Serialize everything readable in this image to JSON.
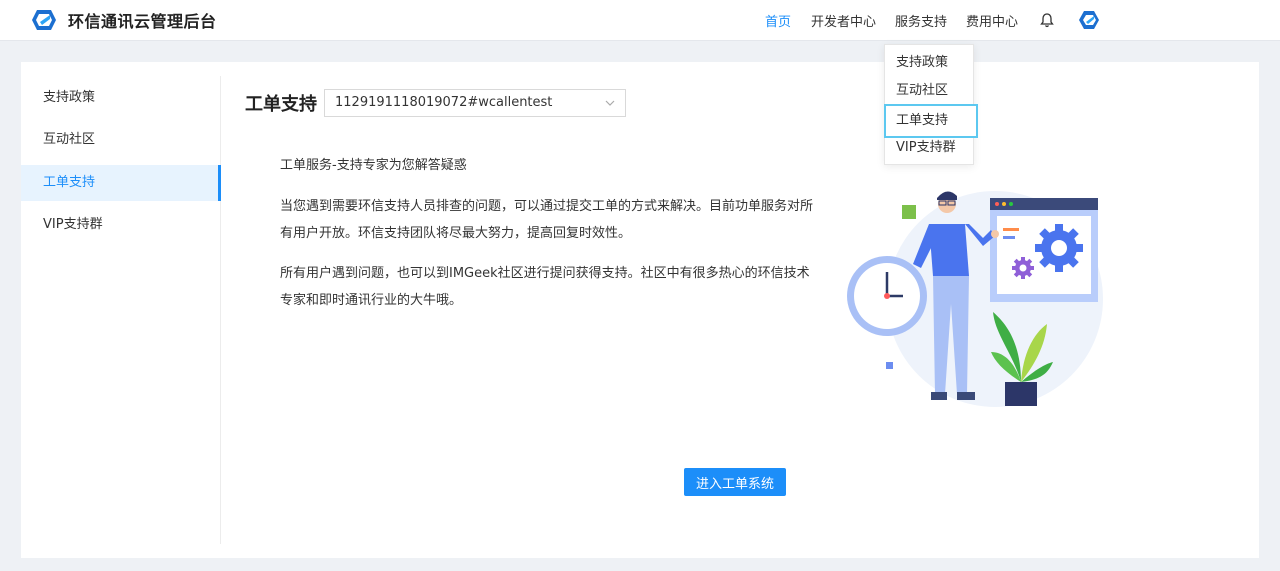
{
  "app": {
    "title": "环信通讯云管理后台"
  },
  "nav": {
    "items": [
      {
        "label": "首页",
        "active": true
      },
      {
        "label": "开发者中心",
        "active": false
      },
      {
        "label": "服务支持",
        "active": false
      },
      {
        "label": "费用中心",
        "active": false
      }
    ]
  },
  "dropdown": {
    "items": [
      {
        "label": "支持政策",
        "active": false
      },
      {
        "label": "互动社区",
        "active": false
      },
      {
        "label": "工单支持",
        "active": true
      },
      {
        "label": "VIP支持群",
        "active": false
      }
    ]
  },
  "sidebar": {
    "items": [
      {
        "label": "支持政策",
        "active": false
      },
      {
        "label": "互动社区",
        "active": false
      },
      {
        "label": "工单支持",
        "active": true
      },
      {
        "label": "VIP支持群",
        "active": false
      }
    ]
  },
  "main": {
    "title": "工单支持",
    "app_selector": "1129191118019072#wcallentest",
    "headline": "工单服务-支持专家为您解答疑惑",
    "paragraph1": "当您遇到需要环信支持人员排查的问题，可以通过提交工单的方式来解决。目前功单服务对所有用户开放。环信支持团队将尽最大努力，提高回复时效性。",
    "paragraph2": "所有用户遇到问题，也可以到IMGeek社区进行提问获得支持。社区中有很多热心的环信技术专家和即时通讯行业的大牛哦。",
    "cta": "进入工单系统"
  },
  "colors": {
    "accent": "#1c8ef9",
    "highlight": "#5cc8f0"
  }
}
